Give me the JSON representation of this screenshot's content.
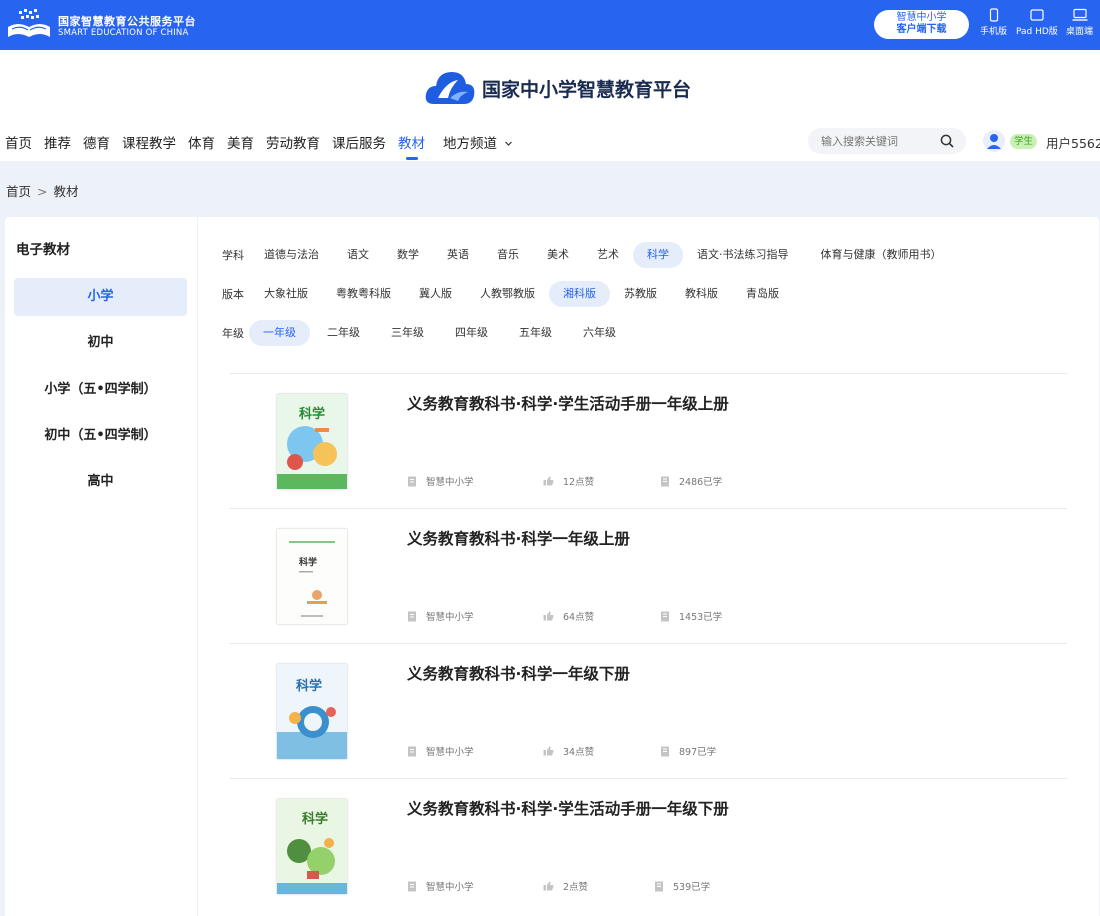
{
  "topbar": {
    "title_cn": "国家智慧教育公共服务平台",
    "title_en": "SMART EDUCATION OF CHINA",
    "download_line1": "智慧中小学",
    "download_line2": "客户端下载",
    "devices": [
      {
        "label": "手机版",
        "icon": "phone-icon"
      },
      {
        "label": "Pad HD版",
        "icon": "tablet-icon"
      },
      {
        "label": "桌面端",
        "icon": "desktop-icon"
      }
    ]
  },
  "header": {
    "brand": "国家中小学智慧教育平台",
    "nav": [
      "首页",
      "推荐",
      "德育",
      "课程教学",
      "体育",
      "美育",
      "劳动教育",
      "课后服务",
      "教材",
      "地方频道"
    ],
    "nav_active": 8,
    "search_placeholder": "输入搜索关键词",
    "role_badge": "学生",
    "username": "用户5562"
  },
  "breadcrumb": {
    "home": "首页",
    "sep": ">",
    "current": "教材"
  },
  "sidebar": {
    "title": "电子教材",
    "items": [
      "小学",
      "初中",
      "小学（五•四学制）",
      "初中（五•四学制）",
      "高中"
    ],
    "active": 0
  },
  "filters": {
    "subject": {
      "label": "学科",
      "options": [
        "道德与法治",
        "语文",
        "数学",
        "英语",
        "音乐",
        "美术",
        "艺术",
        "科学",
        "语文·书法练习指导",
        "体育与健康（教师用书）"
      ],
      "active": 7
    },
    "edition": {
      "label": "版本",
      "options": [
        "大象社版",
        "粤教粤科版",
        "冀人版",
        "人教鄂教版",
        "湘科版",
        "苏教版",
        "教科版",
        "青岛版"
      ],
      "active": 4
    },
    "grade": {
      "label": "年级",
      "options": [
        "一年级",
        "二年级",
        "三年级",
        "四年级",
        "五年级",
        "六年级"
      ],
      "active": 0
    }
  },
  "books": [
    {
      "title": "义务教育教科书·科学·学生活动手册一年级上册",
      "source": "智慧中小学",
      "likes": "12点赞",
      "learned": "2486已学",
      "cover": "colorful"
    },
    {
      "title": "义务教育教科书·科学一年级上册",
      "source": "智慧中小学",
      "likes": "64点赞",
      "learned": "1453已学",
      "cover": "plain"
    },
    {
      "title": "义务教育教科书·科学一年级下册",
      "source": "智慧中小学",
      "likes": "34点赞",
      "learned": "897已学",
      "cover": "blue"
    },
    {
      "title": "义务教育教科书·科学·学生活动手册一年级下册",
      "source": "智慧中小学",
      "likes": "2点赞",
      "learned": "539已学",
      "cover": "green"
    }
  ],
  "cover_text": "科学",
  "colors": {
    "primary": "#2764f0",
    "active_bg": "#e5edfb",
    "badge_bg": "#c9f0b5",
    "badge_fg": "#43a227"
  }
}
